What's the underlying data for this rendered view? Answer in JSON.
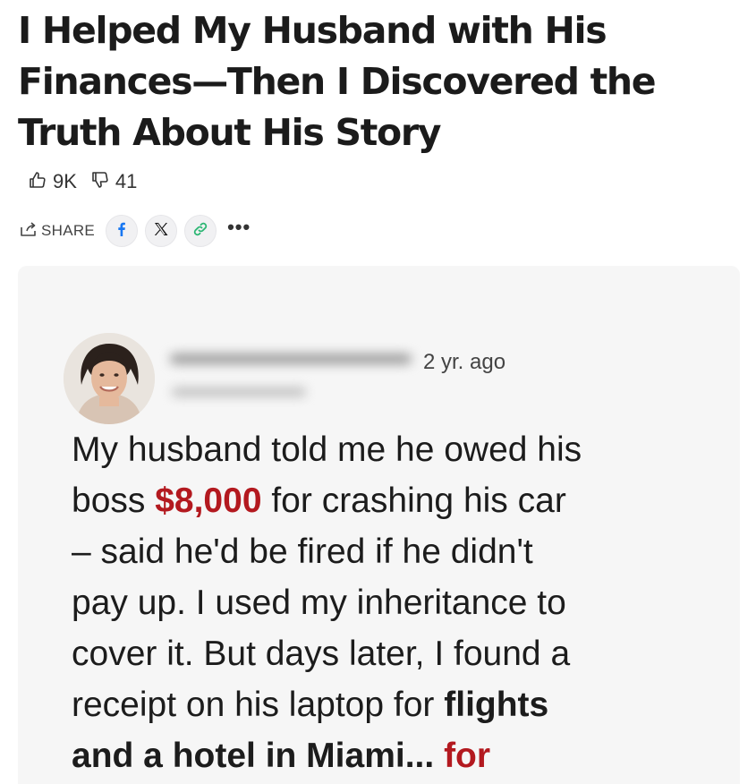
{
  "article": {
    "title": "I Helped My Husband with His Finances—Then I Discovered the Truth About His Story"
  },
  "reactions": {
    "likes": "9K",
    "dislikes": "41"
  },
  "share": {
    "label": "SHARE",
    "more": "•••"
  },
  "icons": {
    "like": "thumbs-up-icon",
    "dislike": "thumbs-down-icon",
    "share": "share-icon",
    "facebook": "facebook-icon",
    "x": "x-icon",
    "link": "link-icon"
  },
  "colors": {
    "highlight_red": "#b3191f",
    "facebook_blue": "#1877f2",
    "link_green": "#2bb673"
  },
  "post": {
    "time": "2 yr. ago",
    "lines": [
      [
        {
          "t": "My husband told me he owed his",
          "s": "normal"
        }
      ],
      [
        {
          "t": "boss ",
          "s": "normal"
        },
        {
          "t": "$8,000",
          "s": "red-bold"
        },
        {
          "t": " for crashing his car",
          "s": "normal"
        }
      ],
      [
        {
          "t": "– said he'd be fired if he didn't",
          "s": "normal"
        }
      ],
      [
        {
          "t": "pay up. I used my inheritance to",
          "s": "normal"
        }
      ],
      [
        {
          "t": "cover it. But days later, I found a",
          "s": "normal"
        }
      ],
      [
        {
          "t": "receipt on his laptop for ",
          "s": "normal"
        },
        {
          "t": "flights",
          "s": "bold"
        }
      ],
      [
        {
          "t": "and a hotel in Miami... ",
          "s": "bold"
        },
        {
          "t": "for",
          "s": "red-bold"
        }
      ]
    ]
  }
}
